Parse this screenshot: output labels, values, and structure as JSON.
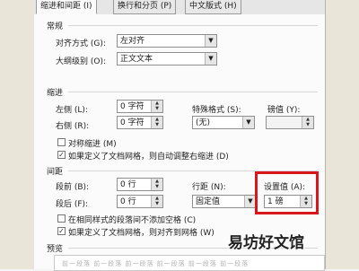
{
  "tabs": [
    "缩进和间距 (I)",
    "换行和分页 (P)",
    "中文版式 (H)"
  ],
  "general": {
    "heading": "常规",
    "alignment_label": "对齐方式 (G):",
    "alignment_value": "左对齐",
    "outline_label": "大纲级别 (O):",
    "outline_value": "正文文本"
  },
  "indent": {
    "heading": "缩进",
    "left_label": "左侧 (L):",
    "left_value": "0 字符",
    "right_label": "右侧 (R):",
    "right_value": "0 字符",
    "special_label": "特殊格式 (S):",
    "special_value": "(无)",
    "by_label": "磅值 (Y):",
    "by_value": "",
    "mirror_label": "对称缩进 (M)",
    "grid_label": "如果定义了文档网格，则自动调整右缩进 (D)"
  },
  "spacing": {
    "heading": "间距",
    "before_label": "段前 (B):",
    "before_value": "0 行",
    "after_label": "段后 (F):",
    "after_value": "0 行",
    "line_label": "行距 (N):",
    "line_value": "固定值",
    "at_label": "设置值 (A):",
    "at_value": "1 磅",
    "no_space_label": "在相同样式的段落间不添加空格 (C)",
    "snap_label": "如果定义了文档网格，则对齐到网格 (W)"
  },
  "preview": {
    "heading": "预览",
    "placeholder": "前一段落 前一段落 前一段落 前一段落 前一段落 前一段落"
  },
  "watermark": "易坊好文馆",
  "colors": {
    "highlight": "#d8161b"
  }
}
